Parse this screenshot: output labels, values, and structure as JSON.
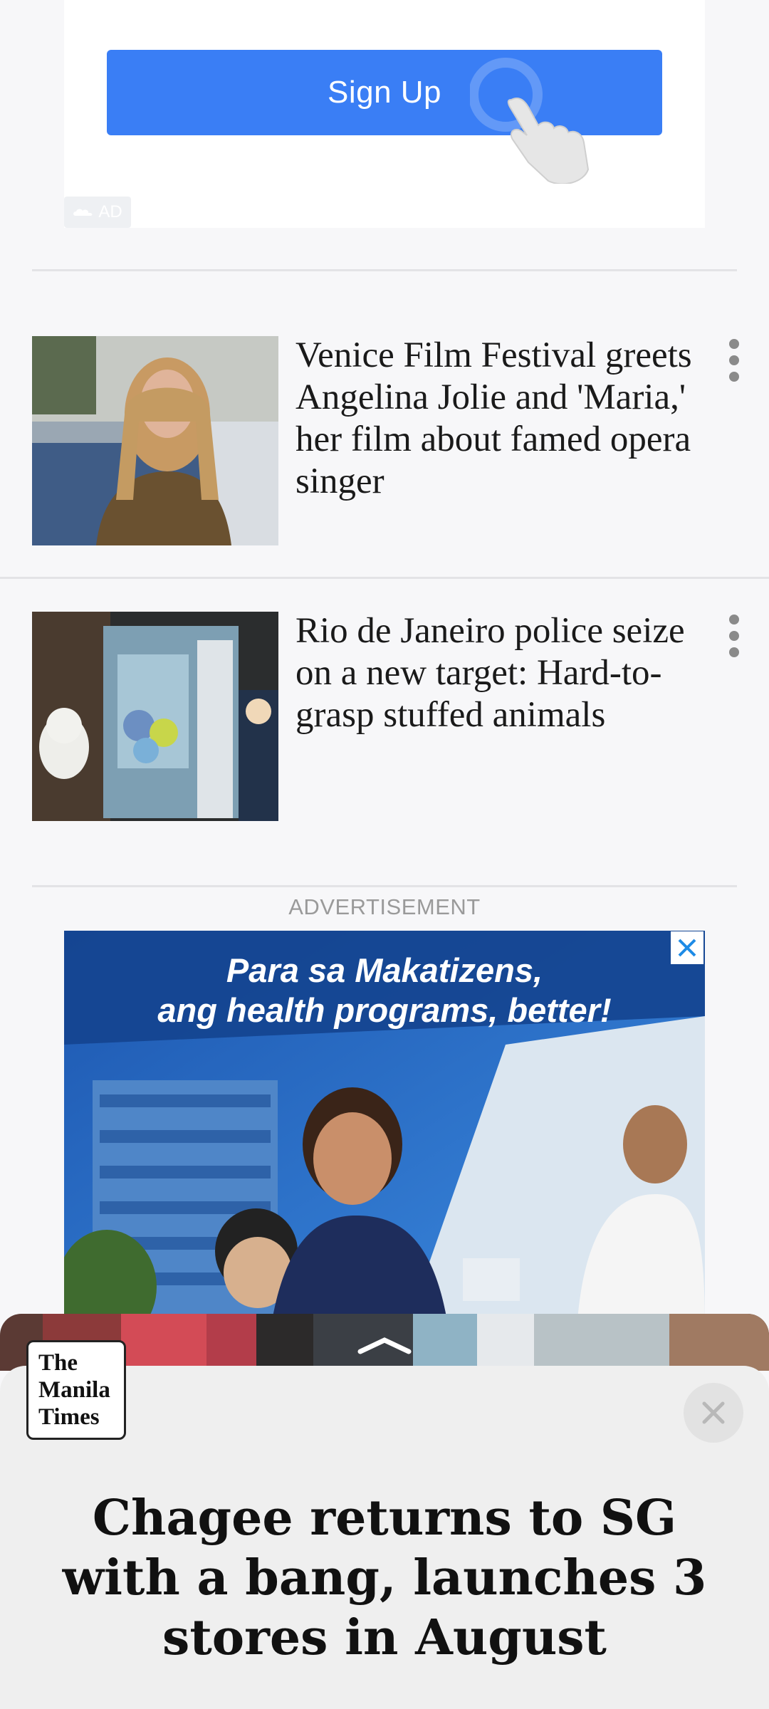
{
  "top_ad": {
    "button_label": "Sign Up",
    "badge_label": "AD"
  },
  "articles": [
    {
      "headline": "Venice Film Festival greets Angelina Jolie and 'Maria,' her film about famed opera singer",
      "thumbnail_icon": "portrait-photo"
    },
    {
      "headline": "Rio de Janeiro police seize on a new target: Hard-to-grasp stuffed animals",
      "thumbnail_icon": "claw-machine-photo"
    }
  ],
  "advertisement": {
    "label": "ADVERTISEMENT",
    "banner_line1": "Para sa Makatizens,",
    "banner_line2": "ang health programs, better!"
  },
  "bottom_sheet": {
    "logo_line1": "The",
    "logo_line2": "Manila",
    "logo_line3": "Times",
    "title": "Chagee returns to SG with a bang, launches 3 stores in August"
  },
  "colors": {
    "accent_blue": "#3a7ef5",
    "background": "#f7f7f9",
    "sheet": "#efefef"
  }
}
